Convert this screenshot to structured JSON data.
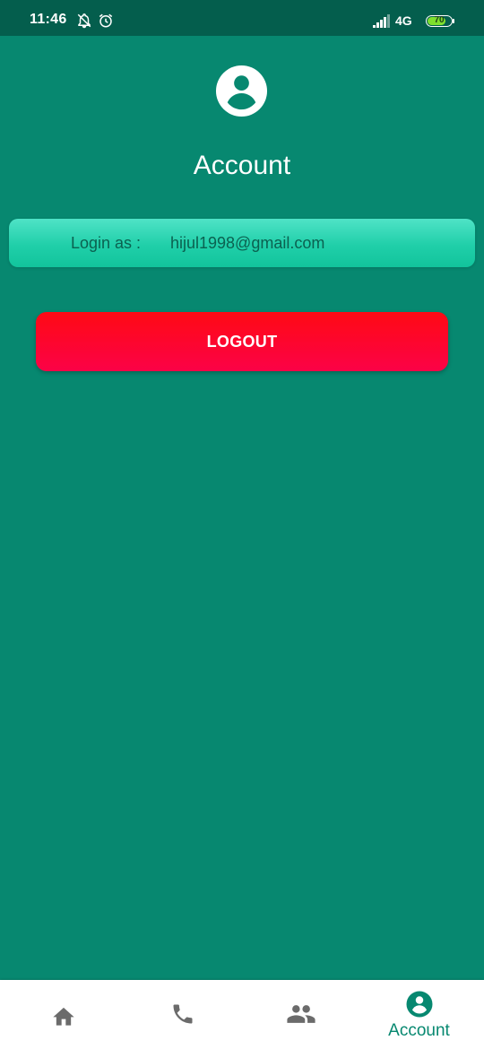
{
  "status_bar": {
    "time": "11:46",
    "network": "4G",
    "battery": "70",
    "icons": [
      "notifications-off-icon",
      "alarm-icon",
      "signal-icon",
      "battery-icon"
    ]
  },
  "header": {
    "avatar_icon": "account-circle-icon",
    "title": "Account"
  },
  "login_card": {
    "label": "Login as :",
    "email": "hijul1998@gmail.com"
  },
  "logout_button": {
    "label": "LOGOUT"
  },
  "bottom_nav": {
    "items": [
      {
        "icon": "home-icon",
        "label": ""
      },
      {
        "icon": "phone-icon",
        "label": ""
      },
      {
        "icon": "people-icon",
        "label": ""
      },
      {
        "icon": "account-circle-icon",
        "label": "Account",
        "active": true
      }
    ]
  },
  "colors": {
    "background": "#078870",
    "status_bar": "#045e4d",
    "card_gradient_top": "#4fe3c7",
    "card_gradient_bottom": "#12c49c",
    "logout_red": "#ff0a14",
    "logout_pink": "#fb0247",
    "nav_active": "#078870",
    "nav_inactive": "#6b6b6b"
  }
}
